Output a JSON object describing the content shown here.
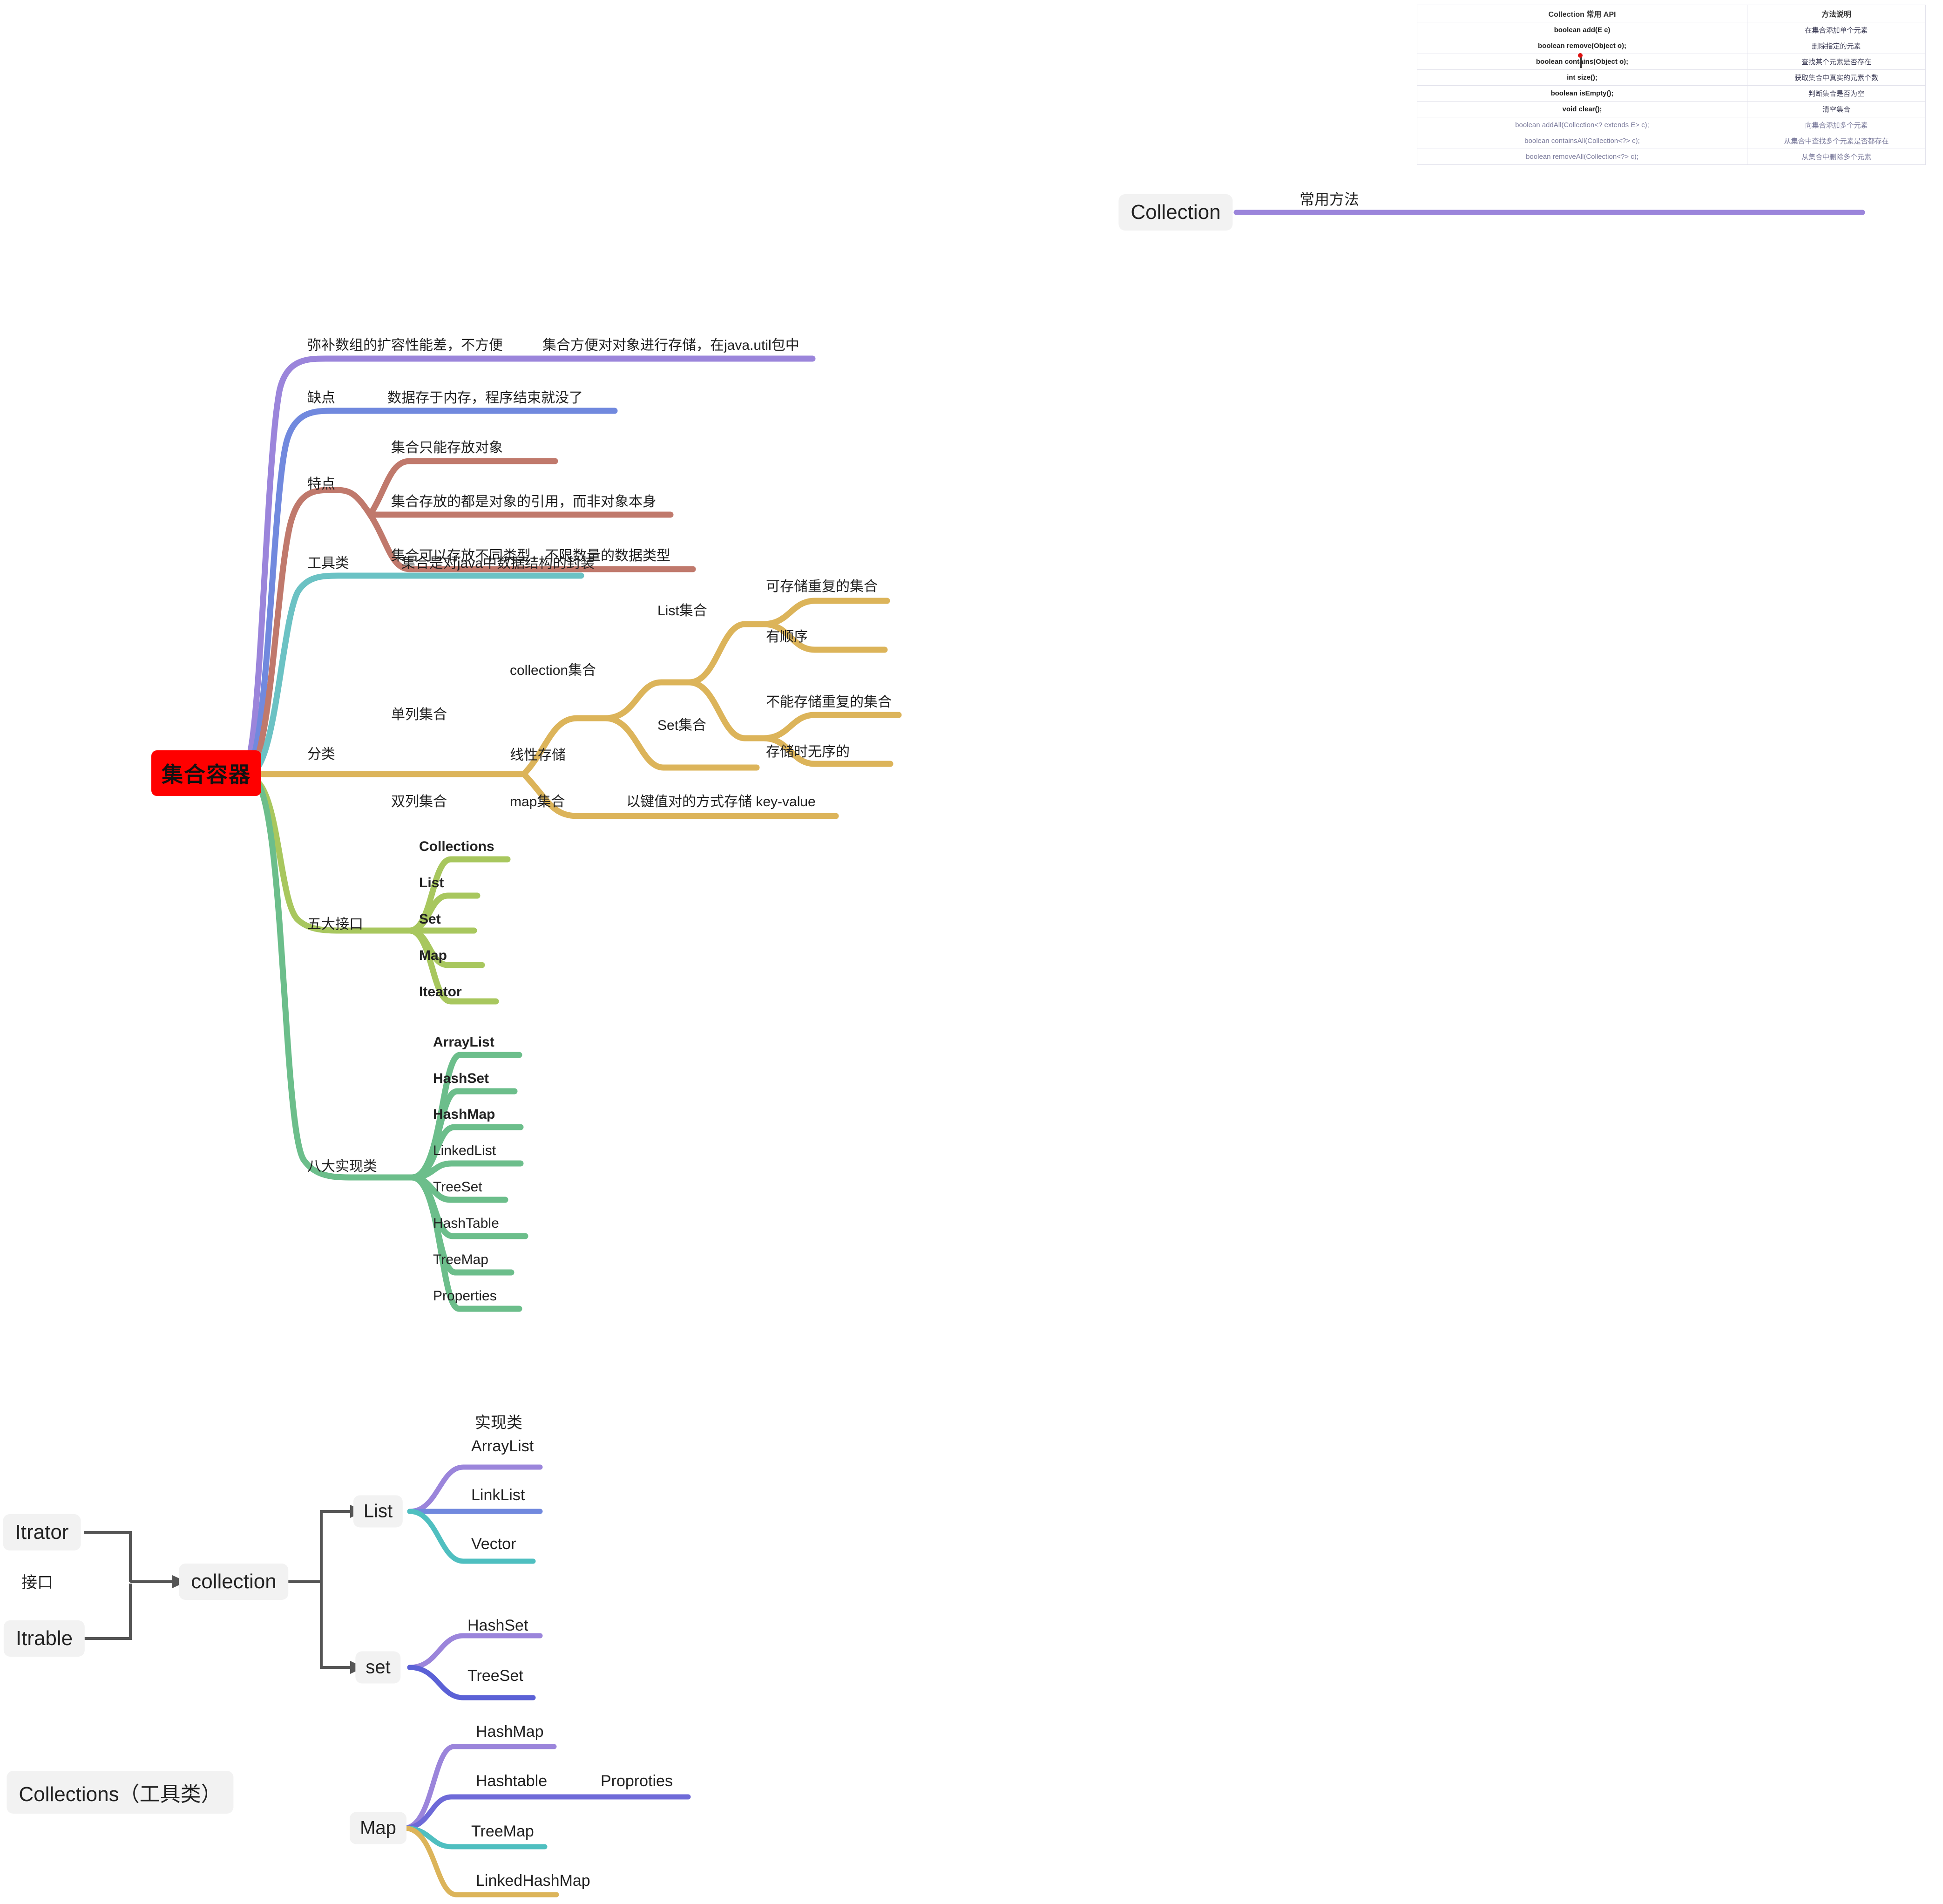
{
  "api_panel": {
    "node_label": "Collection",
    "link_label": "常用方法",
    "table": {
      "headers": [
        "Collection 常用 API",
        "方法说明"
      ],
      "rows": [
        {
          "method": "boolean add(E e)",
          "desc": "在集合添加单个元素",
          "dim": false
        },
        {
          "method": "boolean remove(Object o);",
          "desc": "删除指定的元素",
          "dim": false
        },
        {
          "method": "boolean contains(Object o);",
          "desc": "查找某个元素是否存在",
          "dim": false
        },
        {
          "method": "int size();",
          "desc": "获取集合中真实的元素个数",
          "dim": false
        },
        {
          "method": "boolean isEmpty();",
          "desc": "判断集合是否为空",
          "dim": false
        },
        {
          "method": "void clear();",
          "desc": "清空集合",
          "dim": false
        },
        {
          "method": "boolean addAll(Collection<? extends E> c);",
          "desc": "向集合添加多个元素",
          "dim": true
        },
        {
          "method": "boolean containsAll(Collection<?> c);",
          "desc": "从集合中查找多个元素是否都存在",
          "dim": true
        },
        {
          "method": "boolean removeAll(Collection<?> c);",
          "desc": "从集合中删除多个元素",
          "dim": true
        }
      ]
    }
  },
  "mindmap": {
    "root": "集合容器",
    "branches": [
      {
        "label": "",
        "color": "#9B85DB",
        "leaves": [
          "弥补数组的扩容性能差，不方便",
          "集合方便对对象进行存储，在java.util包中"
        ]
      },
      {
        "label": "缺点",
        "color": "#7189DE",
        "leaves": [
          "数据存于内存，程序结束就没了"
        ]
      },
      {
        "label": "特点",
        "color": "#C0796C",
        "leaves": [
          "集合只能存放对象",
          "集合存放的都是对象的引用，而非对象本身",
          "集合可以存放不同类型，不限数量的数据类型"
        ]
      },
      {
        "label": "工具类",
        "color": "#6BC2C4",
        "leaves": [
          "集合是对java中数据结构的封装"
        ]
      },
      {
        "label": "分类",
        "color": "#DCB45A",
        "leaves": [
          "单列集合",
          "collection集合",
          "List集合",
          "可存储重复的集合",
          "有顺序",
          "Set集合",
          "不能存储重复的集合",
          "存储时无序的",
          "线性存储",
          "双列集合",
          "map集合",
          "以键值对的方式存储  key-value"
        ]
      },
      {
        "label": "五大接口",
        "color": "#A8C75E",
        "leaves": [
          "Collections",
          "List",
          "Set",
          "Map",
          "Iteator"
        ]
      },
      {
        "label": "八大实现类",
        "color": "#6CBE8B",
        "leaves": [
          "ArrayList",
          "HashSet",
          "HashMap",
          "LinkedList",
          "TreeSet",
          "HashTable",
          "TreeMap",
          "Properties"
        ]
      }
    ]
  },
  "flow": {
    "nodes": {
      "itrator": "Itrator",
      "itrable": "Itrable",
      "interface_label": "接口",
      "collection": "collection",
      "list": "List",
      "set": "set",
      "impl_label": "实现类"
    },
    "list_children": [
      "ArrayList",
      "LinkList",
      "Vector"
    ],
    "set_children": [
      "HashSet",
      "TreeSet"
    ],
    "collections_tool": "Collections（工具类）",
    "map_node": "Map",
    "map_children": [
      "HashMap",
      "Hashtable",
      "TreeMap",
      "LinkedHashMap"
    ],
    "map_extra": "Proproties"
  },
  "colors": {
    "root": "#FF0000",
    "purple": "#9B85DB",
    "blue": "#7189DE",
    "salmon": "#C0796C",
    "teal": "#6BC2C4",
    "gold": "#DCB45A",
    "olive": "#A8C75E",
    "green": "#6CBE8B",
    "arrow_grey": "#555555",
    "box_bg": "#f2f2f2"
  }
}
